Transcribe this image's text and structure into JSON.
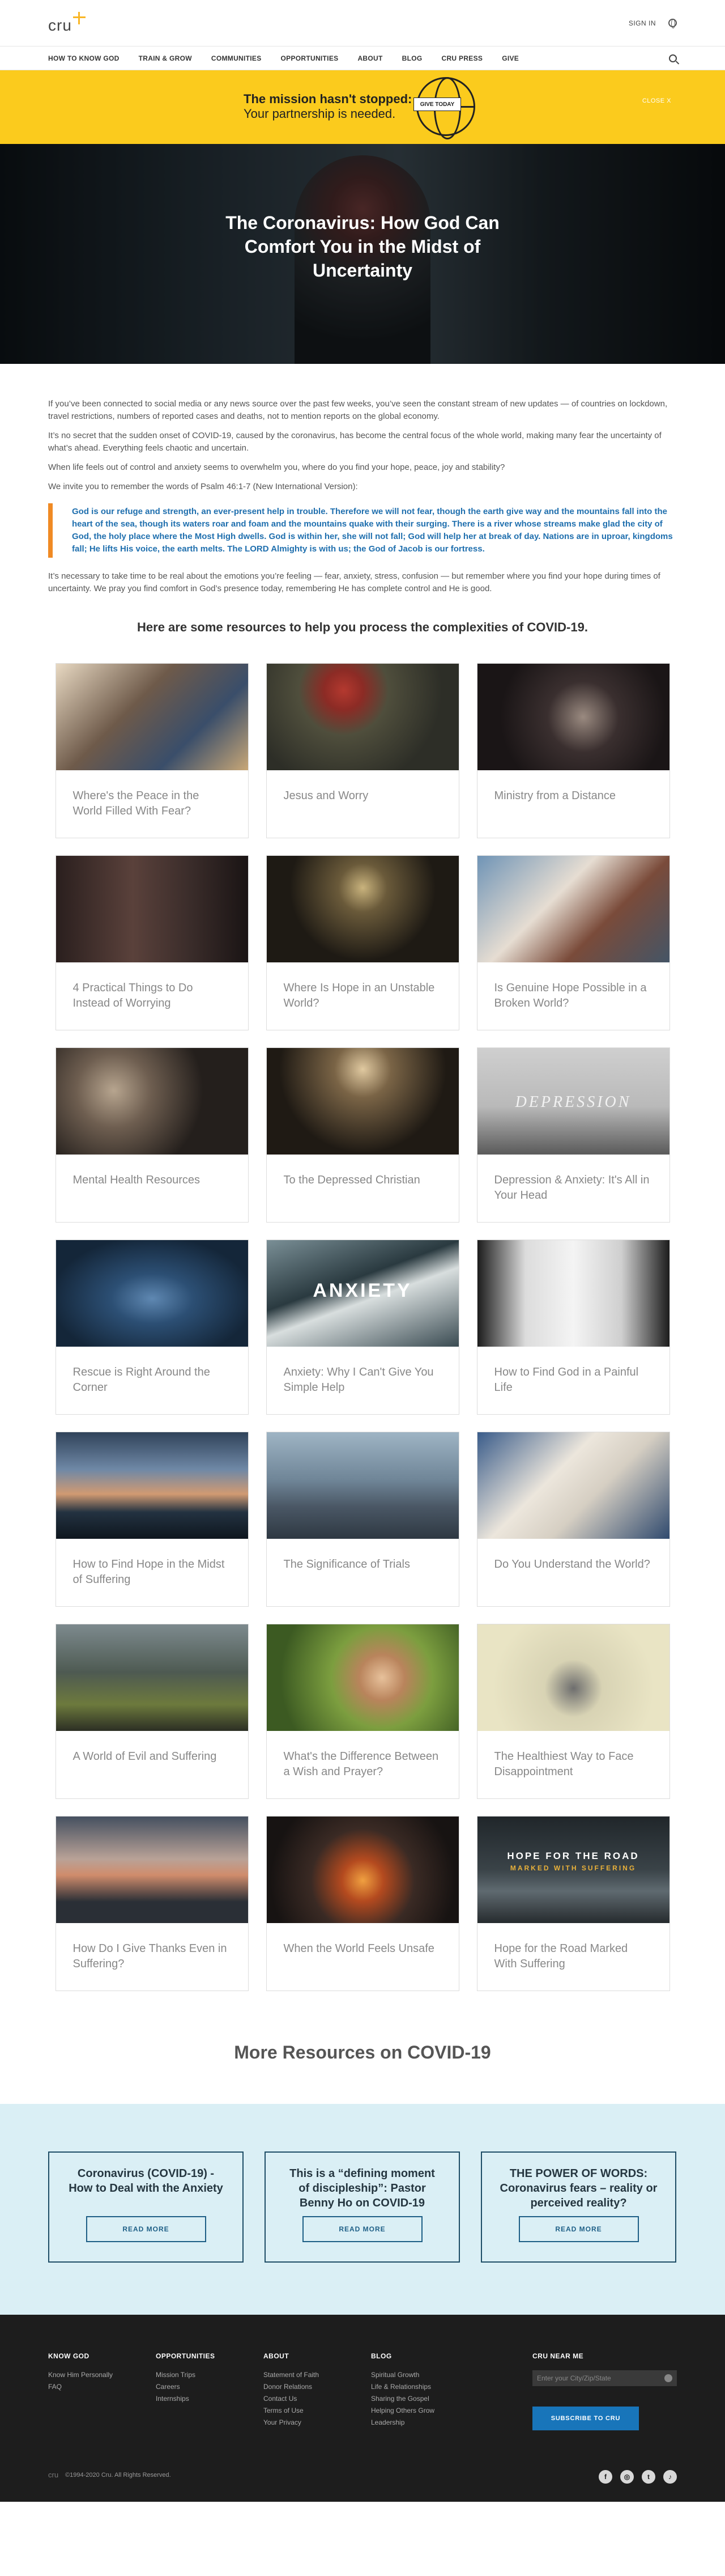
{
  "header": {
    "logo_text": "cru",
    "sign_in": "SIGN IN"
  },
  "nav": {
    "items": [
      "HOW TO KNOW GOD",
      "TRAIN & GROW",
      "COMMUNITIES",
      "OPPORTUNITIES",
      "ABOUT",
      "BLOG",
      "CRU PRESS",
      "GIVE"
    ]
  },
  "banner": {
    "line1": "The mission hasn't stopped:",
    "line2": "Your partnership is needed.",
    "give_label": "GIVE TODAY",
    "close_label": "CLOSE X"
  },
  "hero": {
    "title": "The Coronavirus: How God Can Comfort You in the Midst of Uncertainty"
  },
  "article": {
    "p1": "If you’ve been connected to social media or any news source over the past few weeks, you’ve seen the constant stream of new updates — of countries on lockdown, travel restrictions, numbers of reported cases and deaths, not to mention reports on the global economy.",
    "p2": "It’s no secret that the sudden onset of COVID-19, caused by the coronavirus, has become the central focus of the whole world, making many fear the uncertainty of what’s ahead. Everything feels chaotic and uncertain.",
    "p3": "When life feels out of control and anxiety seems to overwhelm you, where do you find your hope, peace, joy and stability?",
    "p4": "We invite you to remember the words of Psalm 46:1-7 (New International Version):",
    "quote": "God is our refuge and strength, an ever-present help in trouble. Therefore we will not fear, though the earth give way and the mountains fall into the heart of the sea, though its waters roar and foam and the mountains quake with their surging. There is a river whose streams make glad the city of God, the holy place where the Most High dwells. God is within her, she will not fall; God will help her at break of day. Nations are in uproar, kingdoms fall; He lifts His voice, the earth melts. The LORD Almighty is with us; the God of Jacob is our fortress.",
    "p5": "It’s necessary to take time to be real about the emotions you’re feeling — fear, anxiety, stress, confusion — but remember where you find your hope during times of uncertainty. We pray you find comfort in God’s presence today, remembering He has complete control and He is good.",
    "resources_title": "Here are some resources to help you process the complexities of COVID-19."
  },
  "cards": [
    {
      "title": "Where's the Peace in the World Filled With Fear?"
    },
    {
      "title": "Jesus and Worry"
    },
    {
      "title": "Ministry from a Distance"
    },
    {
      "title": "4 Practical Things to Do Instead of Worrying"
    },
    {
      "title": "Where Is Hope in an Unstable World?"
    },
    {
      "title": "Is Genuine Hope Possible in a Broken World?"
    },
    {
      "title": "Mental Health Resources"
    },
    {
      "title": "To the Depressed Christian"
    },
    {
      "title": "Depression & Anxiety: It's All in Your Head"
    },
    {
      "title": "Rescue is Right Around the Corner"
    },
    {
      "title": "Anxiety: Why I Can't Give You Simple Help"
    },
    {
      "title": "How to Find God in a Painful Life"
    },
    {
      "title": "How to Find Hope in the Midst of Suffering"
    },
    {
      "title": "The Significance of Trials"
    },
    {
      "title": "Do You Understand the World?"
    },
    {
      "title": "A World of Evil and Suffering"
    },
    {
      "title": "What's the Difference Between a Wish and Prayer?"
    },
    {
      "title": "The Healthiest Way to Face Disappointment"
    },
    {
      "title": "How Do I Give Thanks Even in Suffering?"
    },
    {
      "title": "When the World Feels Unsafe"
    },
    {
      "title": "Hope for the Road Marked With Suffering"
    }
  ],
  "thumb_text": {
    "depression": "DEPRESSION",
    "anxiety": "ANXIETY",
    "hope_line1": "HOPE FOR THE ROAD",
    "hope_line2": "MARKED WITH SUFFERING"
  },
  "more_title": "More Resources on COVID-19",
  "features": [
    {
      "title": "Coronavirus (COVID-19) - How to Deal with the Anxiety",
      "button": "READ MORE"
    },
    {
      "title": "This is a “defining moment of discipleship”: Pastor Benny Ho on COVID-19",
      "button": "READ MORE"
    },
    {
      "title": "THE POWER OF WORDS: Coronavirus fears – reality or perceived reality?",
      "button": "READ MORE"
    }
  ],
  "footer": {
    "cols": [
      {
        "heading": "KNOW GOD",
        "links": [
          "Know Him Personally",
          "FAQ"
        ]
      },
      {
        "heading": "OPPORTUNITIES",
        "links": [
          "Mission Trips",
          "Careers",
          "Internships"
        ]
      },
      {
        "heading": "ABOUT",
        "links": [
          "Statement of Faith",
          "Donor Relations",
          "Contact Us",
          "Terms of Use",
          "Your Privacy"
        ]
      },
      {
        "heading": "BLOG",
        "links": [
          "Spiritual Growth",
          "Life & Relationships",
          "Sharing the Gospel",
          "Helping Others Grow",
          "Leadership"
        ]
      }
    ],
    "near_heading": "CRU NEAR ME",
    "near_placeholder": "Enter your City/Zip/State",
    "subscribe": "SUBSCRIBE TO CRU",
    "copyright": "©1994-2020 Cru. All Rights Reserved.",
    "mini_logo": "cru",
    "social": [
      "f",
      "◎",
      "t",
      "♪"
    ]
  }
}
